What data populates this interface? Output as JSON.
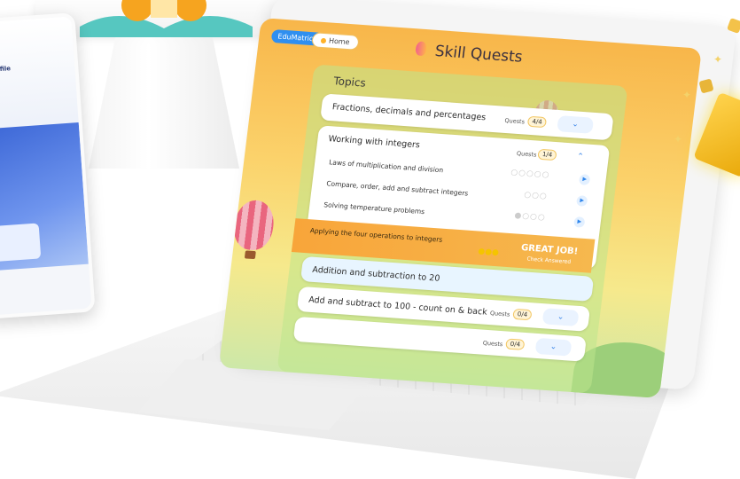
{
  "app": {
    "brand_chip": "EduMatrics",
    "home_chip": "Home",
    "title": "Skill Quests"
  },
  "panel": {
    "heading": "Topics"
  },
  "topics": [
    {
      "title": "Fractions, decimals and percentages",
      "quests_label": "Quests",
      "quests_value": "4/4",
      "toggle": "chevron-down-icon"
    },
    {
      "title": "Working with integers",
      "quests_label": "Quests",
      "quests_value": "1/4",
      "toggle": "chevron-up-icon",
      "subtopics": [
        {
          "title": "Laws of multiplication and division"
        },
        {
          "title": "Compare, order, add and subtract integers"
        },
        {
          "title": "Solving temperature problems"
        },
        {
          "title": "Applying the four operations to integers",
          "banner_title": "GREAT JOB!",
          "banner_subtitle": "Check Answered"
        }
      ]
    },
    {
      "title": "Addition and subtraction to 20",
      "quests_label": "",
      "quests_value": "",
      "toggle": ""
    },
    {
      "title": "Add and subtract to 100 - count on & back",
      "quests_label": "Quests",
      "quests_value": "0/4",
      "toggle": "chevron-down-icon"
    },
    {
      "title": "",
      "quests_label": "Quests",
      "quests_value": "0/4",
      "toggle": "chevron-down-icon"
    }
  ],
  "tablet": {
    "title": "My Profile"
  },
  "colors": {
    "accent_blue": "#2f8ff0",
    "orange": "#f8a53a",
    "gold": "#f3c24a"
  }
}
